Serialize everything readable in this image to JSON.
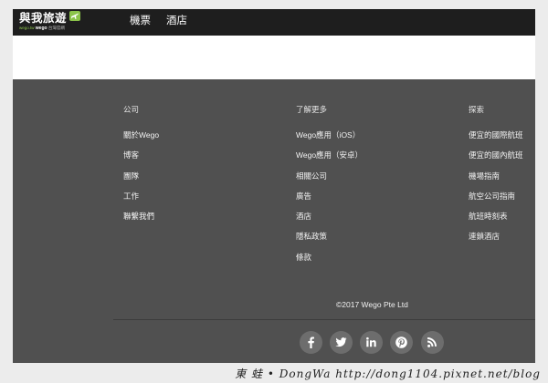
{
  "header": {
    "logo": {
      "title": "與我旅遊",
      "tagline_prefix": "wego.tw",
      "tagline_brand": "wego",
      "tagline_suffix": "台灣官網"
    },
    "nav": [
      {
        "label": "機票"
      },
      {
        "label": "酒店"
      }
    ]
  },
  "footer": {
    "columns": [
      {
        "heading": "公司",
        "links": [
          "關於Wego",
          "博客",
          "團隊",
          "工作",
          "聯繫我們"
        ]
      },
      {
        "heading": "了解更多",
        "links": [
          "Wego應用（iOS）",
          "Wego應用（安卓）",
          "相關公司",
          "廣告",
          "酒店",
          "隱私政策",
          "條款"
        ]
      },
      {
        "heading": "探索",
        "links": [
          "便宜的國際航班",
          "便宜的國內航班",
          "機場指南",
          "航空公司指南",
          "航班時刻表",
          "連鎖酒店"
        ]
      }
    ],
    "copyright": "©2017 Wego Pte Ltd",
    "social": [
      {
        "icon": "facebook-icon"
      },
      {
        "icon": "twitter-icon"
      },
      {
        "icon": "linkedin-icon"
      },
      {
        "icon": "pinterest-icon"
      },
      {
        "icon": "rss-icon"
      }
    ]
  },
  "watermark": "東 蛙 • DongWa http://dong1104.pixnet.net/blog",
  "colors": {
    "nav_bg": "#1e1e1e",
    "footer_bg": "#505050",
    "brand_green": "#8bc34a",
    "social_bg": "#6d6d6d"
  }
}
